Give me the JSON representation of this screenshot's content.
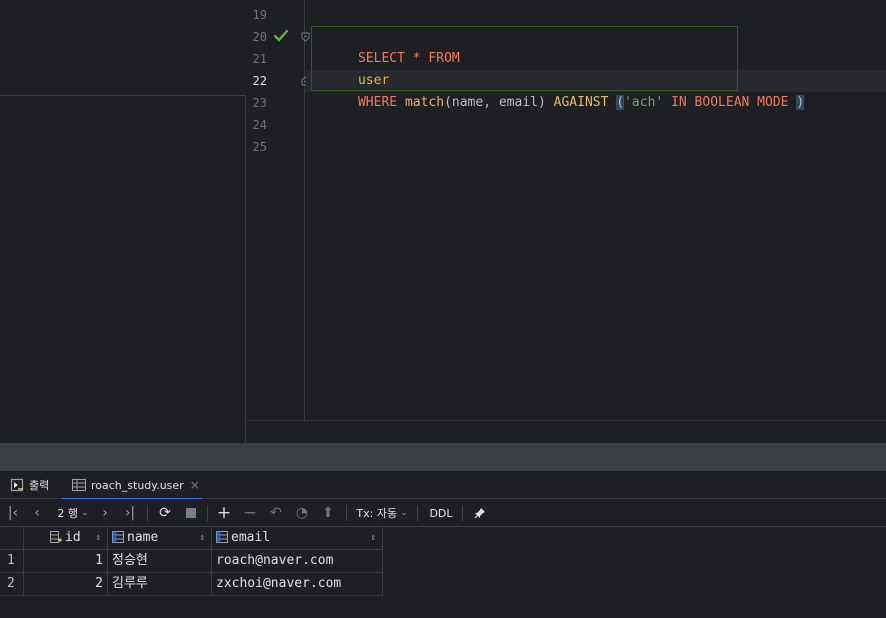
{
  "editor": {
    "line_numbers": [
      "19",
      "20",
      "21",
      "22",
      "23",
      "24",
      "25"
    ],
    "code": {
      "line20": {
        "kw1": "SELECT",
        "star": " * ",
        "kw2": "FROM"
      },
      "line21": {
        "table": "user"
      },
      "line22": {
        "kw_where": "WHERE ",
        "fn_match": "match",
        "args": "(name, email) ",
        "kw_against": "AGAINST",
        "space": " ",
        "open_paren": "(",
        "string": "'ach'",
        "mode": " IN BOOLEAN MODE ",
        "close_paren": ")"
      }
    }
  },
  "results": {
    "tabs": [
      {
        "label": "출력",
        "icon": "output-icon"
      },
      {
        "label": "roach_study.user",
        "icon": "table-icon"
      }
    ],
    "toolbar": {
      "rows_label": "2 행",
      "tx_label": "Tx: 자동",
      "ddl_label": "DDL"
    },
    "columns": [
      "id",
      "name",
      "email"
    ],
    "rows": [
      {
        "num": "1",
        "id": "1",
        "name": "정승현",
        "email": "roach@naver.com"
      },
      {
        "num": "2",
        "id": "2",
        "name": "김루루",
        "email": "zxchoi@naver.com"
      }
    ]
  },
  "colors": {
    "keyword": "#f07a60",
    "string": "#6aab73",
    "check": "#5fb049",
    "accent": "#3574f0"
  }
}
